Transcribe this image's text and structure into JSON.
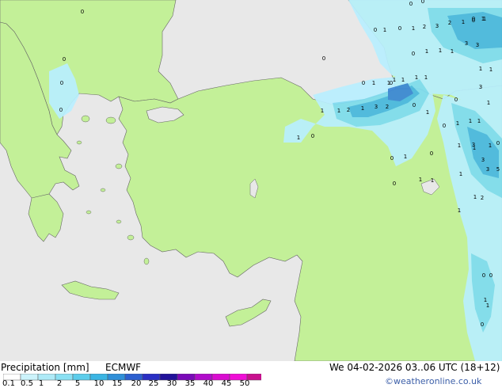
{
  "footer": {
    "title": "Precipitation [mm]",
    "model": "ECMWF",
    "valid_time": "We 04-02-2026 03..06 UTC (18+12)",
    "credit": "©weatheronline.co.uk"
  },
  "legend": {
    "tick_labels": [
      "0.1",
      "0.5",
      "1",
      "2",
      "5",
      "10",
      "15",
      "20",
      "25",
      "30",
      "35",
      "40",
      "45",
      "50"
    ],
    "colors": [
      "#ffffff",
      "#ccf3fb",
      "#aeeaf7",
      "#8ae0f3",
      "#5ccdeb",
      "#3bb5e3",
      "#2f8fd8",
      "#2c5fcf",
      "#2a2fc4",
      "#22129a",
      "#7a0ab8",
      "#b10ccb",
      "#d90cd0",
      "#f00ed6",
      "#c8108e"
    ]
  },
  "map": {
    "colors": {
      "sea": "#e8e8e8",
      "land": "#c3f098",
      "outside": "#e6e6e6",
      "precip_light": "#b9efff",
      "precip_mid": "#7fdcf2",
      "precip_heavy": "#49b7e2",
      "precip_max": "#3a86d6",
      "coast": "#666666"
    },
    "labels": [
      {
        "text": "0"
      },
      {
        "text": "0"
      },
      {
        "text": "0"
      },
      {
        "text": "0"
      },
      {
        "text": "1"
      },
      {
        "text": "0"
      },
      {
        "text": "1"
      },
      {
        "text": "0"
      },
      {
        "text": "1"
      },
      {
        "text": "2"
      },
      {
        "text": "3"
      },
      {
        "text": "2"
      },
      {
        "text": "1"
      },
      {
        "text": "0"
      },
      {
        "text": "1"
      },
      {
        "text": "0"
      },
      {
        "text": "1"
      },
      {
        "text": "3"
      },
      {
        "text": "3"
      },
      {
        "text": "0"
      },
      {
        "text": "1"
      },
      {
        "text": "1"
      },
      {
        "text": "0"
      },
      {
        "text": "0"
      },
      {
        "text": "1"
      },
      {
        "text": "3"
      },
      {
        "text": "1"
      },
      {
        "text": "1"
      },
      {
        "text": "1"
      },
      {
        "text": "1"
      },
      {
        "text": "1"
      },
      {
        "text": "2"
      },
      {
        "text": "1"
      },
      {
        "text": "1"
      },
      {
        "text": "3"
      },
      {
        "text": "2"
      },
      {
        "text": "1"
      },
      {
        "text": "0"
      },
      {
        "text": "0"
      },
      {
        "text": "0"
      },
      {
        "text": "1"
      },
      {
        "text": "1"
      },
      {
        "text": "1"
      },
      {
        "text": "1"
      },
      {
        "text": "0"
      },
      {
        "text": "1"
      },
      {
        "text": "1"
      },
      {
        "text": "0"
      },
      {
        "text": "1"
      },
      {
        "text": "3"
      },
      {
        "text": "3"
      },
      {
        "text": "3"
      },
      {
        "text": "0"
      },
      {
        "text": "1"
      },
      {
        "text": "1"
      },
      {
        "text": "5"
      },
      {
        "text": "0"
      },
      {
        "text": "1"
      },
      {
        "text": "1"
      },
      {
        "text": "1"
      },
      {
        "text": "2"
      },
      {
        "text": "0"
      },
      {
        "text": "1"
      },
      {
        "text": "0"
      },
      {
        "text": "0"
      },
      {
        "text": "1"
      },
      {
        "text": "1"
      },
      {
        "text": "0"
      },
      {
        "text": "0"
      },
      {
        "text": "1"
      },
      {
        "text": "0"
      },
      {
        "text": "0"
      },
      {
        "text": "1"
      },
      {
        "text": "1"
      },
      {
        "text": "1"
      }
    ]
  }
}
